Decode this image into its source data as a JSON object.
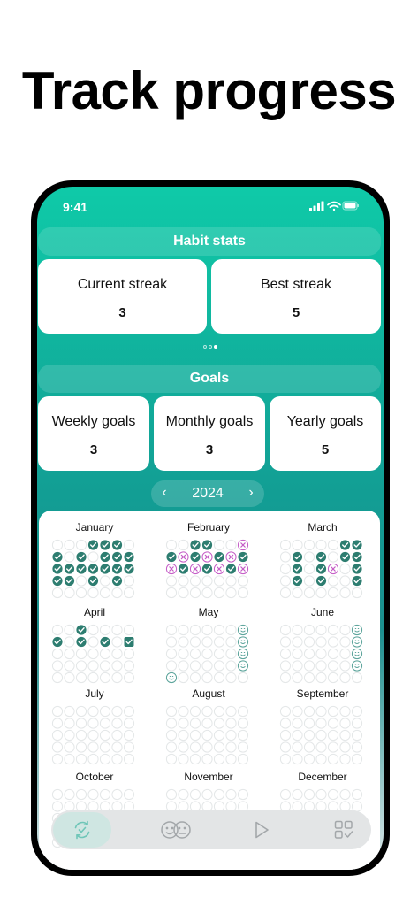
{
  "headline": "Track progress",
  "status": {
    "time": "9:41"
  },
  "habit_stats": {
    "title": "Habit stats",
    "current_label": "Current streak",
    "current_value": "3",
    "best_label": "Best streak",
    "best_value": "5",
    "page_count": 3,
    "active_page": 3
  },
  "goals": {
    "title": "Goals",
    "weekly_label": "Weekly goals",
    "weekly_value": "3",
    "monthly_label": "Monthly goals",
    "monthly_value": "3",
    "yearly_label": "Yearly goals",
    "yearly_value": "5"
  },
  "calendar": {
    "year": "2024",
    "prev_icon": "chevron-left-icon",
    "next_icon": "chevron-right-icon",
    "months": [
      {
        "name": "January",
        "cells": [
          [
            3,
            "d"
          ],
          [
            4,
            "d"
          ],
          [
            5,
            "d"
          ],
          [
            7,
            "d"
          ],
          [
            9,
            "d"
          ],
          [
            11,
            "d"
          ],
          [
            12,
            "d"
          ],
          [
            13,
            "d"
          ],
          [
            14,
            "d"
          ],
          [
            15,
            "d"
          ],
          [
            16,
            "d"
          ],
          [
            17,
            "d"
          ],
          [
            18,
            "d"
          ],
          [
            19,
            "d"
          ],
          [
            20,
            "d"
          ],
          [
            21,
            "d"
          ],
          [
            22,
            "d"
          ],
          [
            24,
            "d"
          ],
          [
            26,
            "d"
          ]
        ]
      },
      {
        "name": "February",
        "cells": [
          [
            2,
            "d"
          ],
          [
            3,
            "d"
          ],
          [
            6,
            "m"
          ],
          [
            7,
            "d"
          ],
          [
            8,
            "m"
          ],
          [
            9,
            "d"
          ],
          [
            10,
            "m"
          ],
          [
            11,
            "d"
          ],
          [
            12,
            "m"
          ],
          [
            13,
            "d"
          ],
          [
            14,
            "m"
          ],
          [
            15,
            "d"
          ],
          [
            16,
            "m"
          ],
          [
            17,
            "d"
          ],
          [
            18,
            "m"
          ],
          [
            19,
            "d"
          ],
          [
            20,
            "m"
          ]
        ]
      },
      {
        "name": "March",
        "cells": [
          [
            5,
            "d"
          ],
          [
            6,
            "d"
          ],
          [
            8,
            "d"
          ],
          [
            10,
            "d"
          ],
          [
            12,
            "d"
          ],
          [
            13,
            "d"
          ],
          [
            15,
            "d"
          ],
          [
            17,
            "d"
          ],
          [
            18,
            "m"
          ],
          [
            20,
            "d"
          ],
          [
            22,
            "d"
          ],
          [
            24,
            "d"
          ],
          [
            27,
            "d"
          ]
        ]
      },
      {
        "name": "April",
        "cells": [
          [
            2,
            "d"
          ],
          [
            7,
            "d"
          ],
          [
            9,
            "d"
          ],
          [
            11,
            "d"
          ],
          [
            13,
            "s"
          ]
        ]
      },
      {
        "name": "May",
        "cells": [
          [
            6,
            "e"
          ],
          [
            13,
            "e"
          ],
          [
            20,
            "e"
          ],
          [
            27,
            "e"
          ],
          [
            28,
            "e"
          ]
        ]
      },
      {
        "name": "June",
        "cells": [
          [
            6,
            "e"
          ],
          [
            13,
            "e"
          ],
          [
            20,
            "e"
          ],
          [
            27,
            "e"
          ]
        ]
      },
      {
        "name": "July",
        "cells": []
      },
      {
        "name": "August",
        "cells": []
      },
      {
        "name": "September",
        "cells": []
      },
      {
        "name": "October",
        "cells": []
      },
      {
        "name": "November",
        "cells": []
      },
      {
        "name": "December",
        "cells": []
      }
    ]
  },
  "tabbar": {
    "tabs": [
      {
        "icon": "habits-sync-icon",
        "active": true
      },
      {
        "icon": "mood-faces-icon",
        "active": false
      },
      {
        "icon": "play-icon",
        "active": false
      },
      {
        "icon": "grid-check-icon",
        "active": false
      }
    ]
  },
  "colors": {
    "teal": "#0fcaa8",
    "check": "#2d7d70",
    "missed": "#c45bc6",
    "empty": "#e4e7e8"
  }
}
